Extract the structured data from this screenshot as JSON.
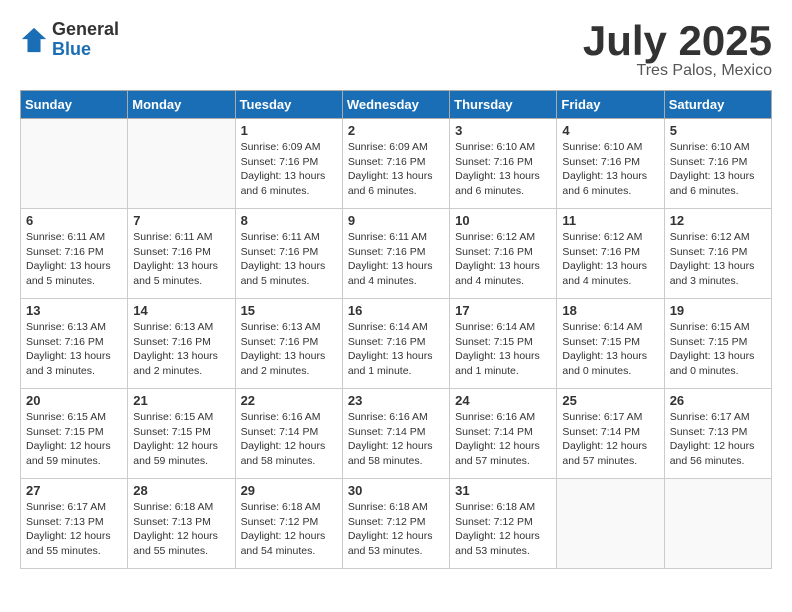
{
  "logo": {
    "general": "General",
    "blue": "Blue"
  },
  "title": "July 2025",
  "subtitle": "Tres Palos, Mexico",
  "days_of_week": [
    "Sunday",
    "Monday",
    "Tuesday",
    "Wednesday",
    "Thursday",
    "Friday",
    "Saturday"
  ],
  "weeks": [
    [
      {
        "day": null,
        "info": null
      },
      {
        "day": null,
        "info": null
      },
      {
        "day": "1",
        "info": "Sunrise: 6:09 AM\nSunset: 7:16 PM\nDaylight: 13 hours\nand 6 minutes."
      },
      {
        "day": "2",
        "info": "Sunrise: 6:09 AM\nSunset: 7:16 PM\nDaylight: 13 hours\nand 6 minutes."
      },
      {
        "day": "3",
        "info": "Sunrise: 6:10 AM\nSunset: 7:16 PM\nDaylight: 13 hours\nand 6 minutes."
      },
      {
        "day": "4",
        "info": "Sunrise: 6:10 AM\nSunset: 7:16 PM\nDaylight: 13 hours\nand 6 minutes."
      },
      {
        "day": "5",
        "info": "Sunrise: 6:10 AM\nSunset: 7:16 PM\nDaylight: 13 hours\nand 6 minutes."
      }
    ],
    [
      {
        "day": "6",
        "info": "Sunrise: 6:11 AM\nSunset: 7:16 PM\nDaylight: 13 hours\nand 5 minutes."
      },
      {
        "day": "7",
        "info": "Sunrise: 6:11 AM\nSunset: 7:16 PM\nDaylight: 13 hours\nand 5 minutes."
      },
      {
        "day": "8",
        "info": "Sunrise: 6:11 AM\nSunset: 7:16 PM\nDaylight: 13 hours\nand 5 minutes."
      },
      {
        "day": "9",
        "info": "Sunrise: 6:11 AM\nSunset: 7:16 PM\nDaylight: 13 hours\nand 4 minutes."
      },
      {
        "day": "10",
        "info": "Sunrise: 6:12 AM\nSunset: 7:16 PM\nDaylight: 13 hours\nand 4 minutes."
      },
      {
        "day": "11",
        "info": "Sunrise: 6:12 AM\nSunset: 7:16 PM\nDaylight: 13 hours\nand 4 minutes."
      },
      {
        "day": "12",
        "info": "Sunrise: 6:12 AM\nSunset: 7:16 PM\nDaylight: 13 hours\nand 3 minutes."
      }
    ],
    [
      {
        "day": "13",
        "info": "Sunrise: 6:13 AM\nSunset: 7:16 PM\nDaylight: 13 hours\nand 3 minutes."
      },
      {
        "day": "14",
        "info": "Sunrise: 6:13 AM\nSunset: 7:16 PM\nDaylight: 13 hours\nand 2 minutes."
      },
      {
        "day": "15",
        "info": "Sunrise: 6:13 AM\nSunset: 7:16 PM\nDaylight: 13 hours\nand 2 minutes."
      },
      {
        "day": "16",
        "info": "Sunrise: 6:14 AM\nSunset: 7:16 PM\nDaylight: 13 hours\nand 1 minute."
      },
      {
        "day": "17",
        "info": "Sunrise: 6:14 AM\nSunset: 7:15 PM\nDaylight: 13 hours\nand 1 minute."
      },
      {
        "day": "18",
        "info": "Sunrise: 6:14 AM\nSunset: 7:15 PM\nDaylight: 13 hours\nand 0 minutes."
      },
      {
        "day": "19",
        "info": "Sunrise: 6:15 AM\nSunset: 7:15 PM\nDaylight: 13 hours\nand 0 minutes."
      }
    ],
    [
      {
        "day": "20",
        "info": "Sunrise: 6:15 AM\nSunset: 7:15 PM\nDaylight: 12 hours\nand 59 minutes."
      },
      {
        "day": "21",
        "info": "Sunrise: 6:15 AM\nSunset: 7:15 PM\nDaylight: 12 hours\nand 59 minutes."
      },
      {
        "day": "22",
        "info": "Sunrise: 6:16 AM\nSunset: 7:14 PM\nDaylight: 12 hours\nand 58 minutes."
      },
      {
        "day": "23",
        "info": "Sunrise: 6:16 AM\nSunset: 7:14 PM\nDaylight: 12 hours\nand 58 minutes."
      },
      {
        "day": "24",
        "info": "Sunrise: 6:16 AM\nSunset: 7:14 PM\nDaylight: 12 hours\nand 57 minutes."
      },
      {
        "day": "25",
        "info": "Sunrise: 6:17 AM\nSunset: 7:14 PM\nDaylight: 12 hours\nand 57 minutes."
      },
      {
        "day": "26",
        "info": "Sunrise: 6:17 AM\nSunset: 7:13 PM\nDaylight: 12 hours\nand 56 minutes."
      }
    ],
    [
      {
        "day": "27",
        "info": "Sunrise: 6:17 AM\nSunset: 7:13 PM\nDaylight: 12 hours\nand 55 minutes."
      },
      {
        "day": "28",
        "info": "Sunrise: 6:18 AM\nSunset: 7:13 PM\nDaylight: 12 hours\nand 55 minutes."
      },
      {
        "day": "29",
        "info": "Sunrise: 6:18 AM\nSunset: 7:12 PM\nDaylight: 12 hours\nand 54 minutes."
      },
      {
        "day": "30",
        "info": "Sunrise: 6:18 AM\nSunset: 7:12 PM\nDaylight: 12 hours\nand 53 minutes."
      },
      {
        "day": "31",
        "info": "Sunrise: 6:18 AM\nSunset: 7:12 PM\nDaylight: 12 hours\nand 53 minutes."
      },
      {
        "day": null,
        "info": null
      },
      {
        "day": null,
        "info": null
      }
    ]
  ]
}
